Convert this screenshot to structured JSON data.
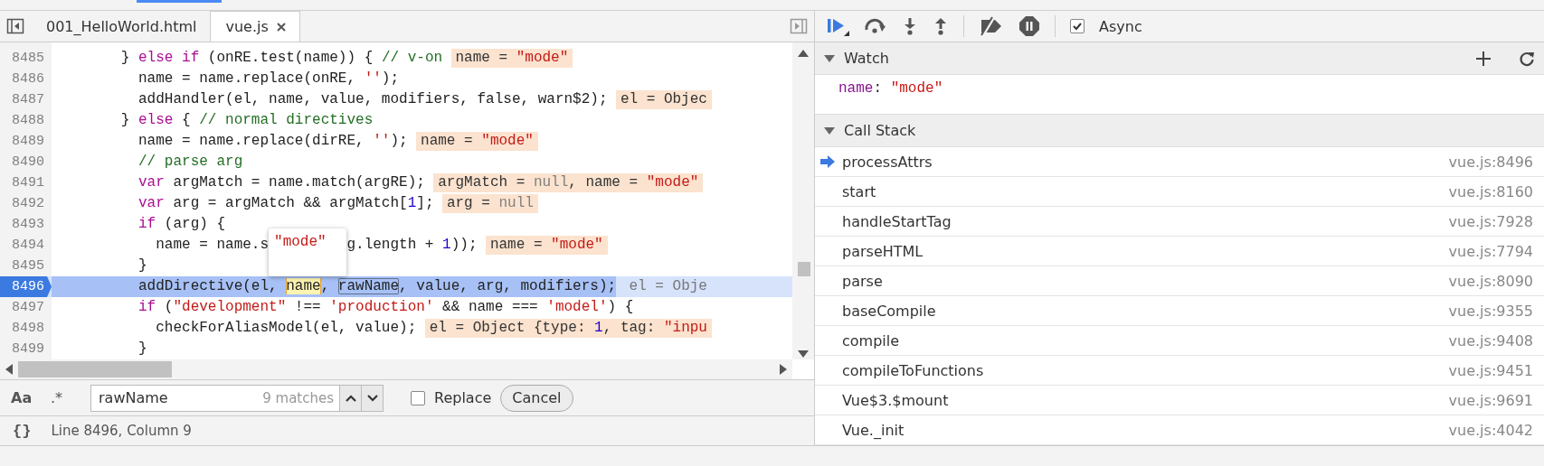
{
  "editor_tabs": [
    {
      "label": "001_HelloWorld.html",
      "selected": false,
      "closable": false
    },
    {
      "label": "vue.js",
      "selected": true,
      "closable": true
    }
  ],
  "code_lines": [
    {
      "number": "8485",
      "current": false,
      "code": [
        {
          "kind": "plain",
          "text": "        } "
        },
        {
          "kind": "keyword",
          "text": "else if"
        },
        {
          "kind": "plain",
          "text": " (onRE.test(name)) { "
        },
        {
          "kind": "comment",
          "text": "// v-on"
        }
      ],
      "values": [
        {
          "kind": "plain",
          "text": "name = "
        },
        {
          "kind": "string",
          "text": "\"mode\""
        }
      ]
    },
    {
      "number": "8486",
      "current": false,
      "code": [
        {
          "kind": "plain",
          "text": "          name = name.replace(onRE, "
        },
        {
          "kind": "string",
          "text": "''"
        },
        {
          "kind": "plain",
          "text": ");"
        }
      ]
    },
    {
      "number": "8487",
      "current": false,
      "code": [
        {
          "kind": "plain",
          "text": "          addHandler(el, name, value, modifiers, false, warn$2);"
        }
      ],
      "values": [
        {
          "kind": "plain",
          "text": "el = Objec"
        }
      ]
    },
    {
      "number": "8488",
      "current": false,
      "code": [
        {
          "kind": "plain",
          "text": "        } "
        },
        {
          "kind": "keyword",
          "text": "else"
        },
        {
          "kind": "plain",
          "text": " { "
        },
        {
          "kind": "comment",
          "text": "// normal directives"
        }
      ]
    },
    {
      "number": "8489",
      "current": false,
      "code": [
        {
          "kind": "plain",
          "text": "          name = name.replace(dirRE, "
        },
        {
          "kind": "string",
          "text": "''"
        },
        {
          "kind": "plain",
          "text": ");"
        }
      ],
      "values": [
        {
          "kind": "plain",
          "text": "name = "
        },
        {
          "kind": "string",
          "text": "\"mode\""
        }
      ]
    },
    {
      "number": "8490",
      "current": false,
      "code": [
        {
          "kind": "comment",
          "text": "          // parse arg"
        }
      ]
    },
    {
      "number": "8491",
      "current": false,
      "code": [
        {
          "kind": "keyword",
          "text": "          var"
        },
        {
          "kind": "plain",
          "text": " argMatch = name.match(argRE);"
        }
      ],
      "values": [
        {
          "kind": "plain",
          "text": "argMatch = "
        },
        {
          "kind": "null",
          "text": "null"
        },
        {
          "kind": "plain",
          "text": ", name = "
        },
        {
          "kind": "string",
          "text": "\"mode\""
        }
      ]
    },
    {
      "number": "8492",
      "current": false,
      "code": [
        {
          "kind": "keyword",
          "text": "          var"
        },
        {
          "kind": "plain",
          "text": " arg = argMatch && argMatch["
        },
        {
          "kind": "number",
          "text": "1"
        },
        {
          "kind": "plain",
          "text": "];"
        }
      ],
      "values": [
        {
          "kind": "plain",
          "text": "arg = "
        },
        {
          "kind": "null",
          "text": "null"
        }
      ]
    },
    {
      "number": "8493",
      "current": false,
      "code": [
        {
          "kind": "keyword",
          "text": "          if"
        },
        {
          "kind": "plain",
          "text": " (arg) {"
        }
      ]
    },
    {
      "number": "8494",
      "current": false,
      "code": [
        {
          "kind": "plain",
          "text": "            name = name.s"
        },
        {
          "kind": "popover",
          "text": "\"mode\""
        },
        {
          "kind": "plain",
          "text": "g.length + "
        },
        {
          "kind": "number",
          "text": "1"
        },
        {
          "kind": "plain",
          "text": "));"
        }
      ],
      "values": [
        {
          "kind": "plain",
          "text": "name = "
        },
        {
          "kind": "string",
          "text": "\"mode\""
        }
      ]
    },
    {
      "number": "8495",
      "current": false,
      "code": [
        {
          "kind": "plain",
          "text": "          }"
        }
      ]
    },
    {
      "number": "8496",
      "current": true,
      "code": [
        {
          "kind": "plain",
          "text": "          addDirective(el, "
        },
        {
          "kind": "current_match",
          "text": "name"
        },
        {
          "kind": "plain",
          "text": ", "
        },
        {
          "kind": "match",
          "text": "rawName"
        },
        {
          "kind": "plain",
          "text": ", value, arg, modifiers);"
        }
      ],
      "values": [
        {
          "kind": "plain",
          "text": "el = Obje"
        }
      ]
    },
    {
      "number": "8497",
      "current": false,
      "code": [
        {
          "kind": "keyword",
          "text": "          if"
        },
        {
          "kind": "plain",
          "text": " ("
        },
        {
          "kind": "string",
          "text": "\"development\""
        },
        {
          "kind": "plain",
          "text": " !== "
        },
        {
          "kind": "string",
          "text": "'production'"
        },
        {
          "kind": "plain",
          "text": " && name === "
        },
        {
          "kind": "string",
          "text": "'model'"
        },
        {
          "kind": "plain",
          "text": ") {"
        }
      ]
    },
    {
      "number": "8498",
      "current": false,
      "code": [
        {
          "kind": "plain",
          "text": "            checkForAliasModel(el, value);"
        }
      ],
      "values": [
        {
          "kind": "plain",
          "text": "el = Object {type: "
        },
        {
          "kind": "number",
          "text": "1"
        },
        {
          "kind": "plain",
          "text": ", tag: "
        },
        {
          "kind": "string",
          "text": "\"inpu"
        }
      ]
    },
    {
      "number": "8499",
      "current": false,
      "code": [
        {
          "kind": "plain",
          "text": "          }"
        }
      ]
    }
  ],
  "search": {
    "case_label": "Aa",
    "regex_label": ".*",
    "value": "rawName",
    "matches": "9 matches",
    "replace": {
      "label": "Replace",
      "checked": false
    },
    "cancel": "Cancel"
  },
  "status_bar": {
    "format_label": "{}",
    "position": "Line 8496, Column 9"
  },
  "debugger_toolbar": {
    "async": {
      "label": "Async",
      "checked": true
    }
  },
  "watch": {
    "title": "Watch",
    "expanded": true,
    "items": [
      {
        "name": "name",
        "separator": ":",
        "value": "\"mode\""
      }
    ]
  },
  "call_stack": {
    "title": "Call Stack",
    "expanded": true,
    "frames": [
      {
        "name": "processAttrs",
        "location": "vue.js:8496",
        "current": true
      },
      {
        "name": "start",
        "location": "vue.js:8160",
        "current": false
      },
      {
        "name": "handleStartTag",
        "location": "vue.js:7928",
        "current": false
      },
      {
        "name": "parseHTML",
        "location": "vue.js:7794",
        "current": false
      },
      {
        "name": "parse",
        "location": "vue.js:8090",
        "current": false
      },
      {
        "name": "baseCompile",
        "location": "vue.js:9355",
        "current": false
      },
      {
        "name": "compile",
        "location": "vue.js:9408",
        "current": false
      },
      {
        "name": "compileToFunctions",
        "location": "vue.js:9451",
        "current": false
      },
      {
        "name": "Vue$3.$mount",
        "location": "vue.js:9691",
        "current": false
      },
      {
        "name": "Vue._init",
        "location": "vue.js:4042",
        "current": false
      }
    ]
  }
}
